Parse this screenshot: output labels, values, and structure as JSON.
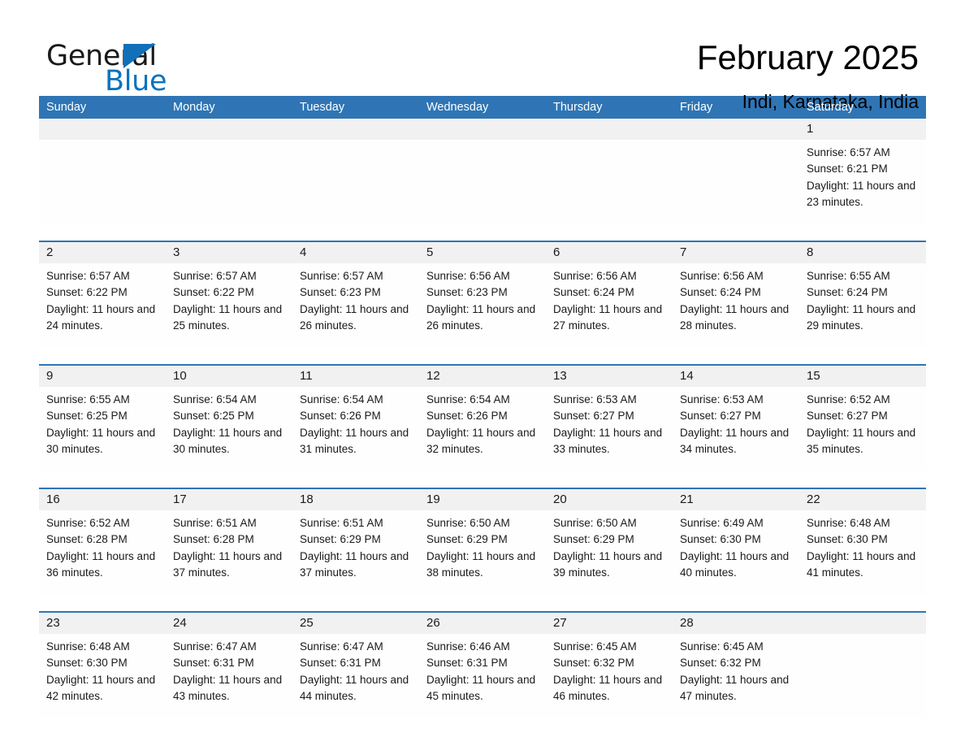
{
  "brand": {
    "name_part1": "General",
    "name_part2": "Blue",
    "logo_icon": "triangle-flag-icon"
  },
  "header": {
    "title": "February 2025",
    "location": "Indi, Karnataka, India"
  },
  "colors": {
    "header_blue": "#2f75b5",
    "brand_blue": "#0a72bd",
    "daynum_band": "#f1f1f1",
    "cell_bg": "#fefefe",
    "text": "#1a1a1a"
  },
  "calendar": {
    "weekday_headers": [
      "Sunday",
      "Monday",
      "Tuesday",
      "Wednesday",
      "Thursday",
      "Friday",
      "Saturday"
    ],
    "weeks": [
      [
        {
          "day": "",
          "sunrise": "",
          "sunset": "",
          "daylight": "",
          "empty": true
        },
        {
          "day": "",
          "sunrise": "",
          "sunset": "",
          "daylight": "",
          "empty": true
        },
        {
          "day": "",
          "sunrise": "",
          "sunset": "",
          "daylight": "",
          "empty": true
        },
        {
          "day": "",
          "sunrise": "",
          "sunset": "",
          "daylight": "",
          "empty": true
        },
        {
          "day": "",
          "sunrise": "",
          "sunset": "",
          "daylight": "",
          "empty": true
        },
        {
          "day": "",
          "sunrise": "",
          "sunset": "",
          "daylight": "",
          "empty": true
        },
        {
          "day": "1",
          "sunrise": "Sunrise: 6:57 AM",
          "sunset": "Sunset: 6:21 PM",
          "daylight": "Daylight: 11 hours and 23 minutes.",
          "empty": false
        }
      ],
      [
        {
          "day": "2",
          "sunrise": "Sunrise: 6:57 AM",
          "sunset": "Sunset: 6:22 PM",
          "daylight": "Daylight: 11 hours and 24 minutes.",
          "empty": false
        },
        {
          "day": "3",
          "sunrise": "Sunrise: 6:57 AM",
          "sunset": "Sunset: 6:22 PM",
          "daylight": "Daylight: 11 hours and 25 minutes.",
          "empty": false
        },
        {
          "day": "4",
          "sunrise": "Sunrise: 6:57 AM",
          "sunset": "Sunset: 6:23 PM",
          "daylight": "Daylight: 11 hours and 26 minutes.",
          "empty": false
        },
        {
          "day": "5",
          "sunrise": "Sunrise: 6:56 AM",
          "sunset": "Sunset: 6:23 PM",
          "daylight": "Daylight: 11 hours and 26 minutes.",
          "empty": false
        },
        {
          "day": "6",
          "sunrise": "Sunrise: 6:56 AM",
          "sunset": "Sunset: 6:24 PM",
          "daylight": "Daylight: 11 hours and 27 minutes.",
          "empty": false
        },
        {
          "day": "7",
          "sunrise": "Sunrise: 6:56 AM",
          "sunset": "Sunset: 6:24 PM",
          "daylight": "Daylight: 11 hours and 28 minutes.",
          "empty": false
        },
        {
          "day": "8",
          "sunrise": "Sunrise: 6:55 AM",
          "sunset": "Sunset: 6:24 PM",
          "daylight": "Daylight: 11 hours and 29 minutes.",
          "empty": false
        }
      ],
      [
        {
          "day": "9",
          "sunrise": "Sunrise: 6:55 AM",
          "sunset": "Sunset: 6:25 PM",
          "daylight": "Daylight: 11 hours and 30 minutes.",
          "empty": false
        },
        {
          "day": "10",
          "sunrise": "Sunrise: 6:54 AM",
          "sunset": "Sunset: 6:25 PM",
          "daylight": "Daylight: 11 hours and 30 minutes.",
          "empty": false
        },
        {
          "day": "11",
          "sunrise": "Sunrise: 6:54 AM",
          "sunset": "Sunset: 6:26 PM",
          "daylight": "Daylight: 11 hours and 31 minutes.",
          "empty": false
        },
        {
          "day": "12",
          "sunrise": "Sunrise: 6:54 AM",
          "sunset": "Sunset: 6:26 PM",
          "daylight": "Daylight: 11 hours and 32 minutes.",
          "empty": false
        },
        {
          "day": "13",
          "sunrise": "Sunrise: 6:53 AM",
          "sunset": "Sunset: 6:27 PM",
          "daylight": "Daylight: 11 hours and 33 minutes.",
          "empty": false
        },
        {
          "day": "14",
          "sunrise": "Sunrise: 6:53 AM",
          "sunset": "Sunset: 6:27 PM",
          "daylight": "Daylight: 11 hours and 34 minutes.",
          "empty": false
        },
        {
          "day": "15",
          "sunrise": "Sunrise: 6:52 AM",
          "sunset": "Sunset: 6:27 PM",
          "daylight": "Daylight: 11 hours and 35 minutes.",
          "empty": false
        }
      ],
      [
        {
          "day": "16",
          "sunrise": "Sunrise: 6:52 AM",
          "sunset": "Sunset: 6:28 PM",
          "daylight": "Daylight: 11 hours and 36 minutes.",
          "empty": false
        },
        {
          "day": "17",
          "sunrise": "Sunrise: 6:51 AM",
          "sunset": "Sunset: 6:28 PM",
          "daylight": "Daylight: 11 hours and 37 minutes.",
          "empty": false
        },
        {
          "day": "18",
          "sunrise": "Sunrise: 6:51 AM",
          "sunset": "Sunset: 6:29 PM",
          "daylight": "Daylight: 11 hours and 37 minutes.",
          "empty": false
        },
        {
          "day": "19",
          "sunrise": "Sunrise: 6:50 AM",
          "sunset": "Sunset: 6:29 PM",
          "daylight": "Daylight: 11 hours and 38 minutes.",
          "empty": false
        },
        {
          "day": "20",
          "sunrise": "Sunrise: 6:50 AM",
          "sunset": "Sunset: 6:29 PM",
          "daylight": "Daylight: 11 hours and 39 minutes.",
          "empty": false
        },
        {
          "day": "21",
          "sunrise": "Sunrise: 6:49 AM",
          "sunset": "Sunset: 6:30 PM",
          "daylight": "Daylight: 11 hours and 40 minutes.",
          "empty": false
        },
        {
          "day": "22",
          "sunrise": "Sunrise: 6:48 AM",
          "sunset": "Sunset: 6:30 PM",
          "daylight": "Daylight: 11 hours and 41 minutes.",
          "empty": false
        }
      ],
      [
        {
          "day": "23",
          "sunrise": "Sunrise: 6:48 AM",
          "sunset": "Sunset: 6:30 PM",
          "daylight": "Daylight: 11 hours and 42 minutes.",
          "empty": false
        },
        {
          "day": "24",
          "sunrise": "Sunrise: 6:47 AM",
          "sunset": "Sunset: 6:31 PM",
          "daylight": "Daylight: 11 hours and 43 minutes.",
          "empty": false
        },
        {
          "day": "25",
          "sunrise": "Sunrise: 6:47 AM",
          "sunset": "Sunset: 6:31 PM",
          "daylight": "Daylight: 11 hours and 44 minutes.",
          "empty": false
        },
        {
          "day": "26",
          "sunrise": "Sunrise: 6:46 AM",
          "sunset": "Sunset: 6:31 PM",
          "daylight": "Daylight: 11 hours and 45 minutes.",
          "empty": false
        },
        {
          "day": "27",
          "sunrise": "Sunrise: 6:45 AM",
          "sunset": "Sunset: 6:32 PM",
          "daylight": "Daylight: 11 hours and 46 minutes.",
          "empty": false
        },
        {
          "day": "28",
          "sunrise": "Sunrise: 6:45 AM",
          "sunset": "Sunset: 6:32 PM",
          "daylight": "Daylight: 11 hours and 47 minutes.",
          "empty": false
        },
        {
          "day": "",
          "sunrise": "",
          "sunset": "",
          "daylight": "",
          "empty": true
        }
      ]
    ]
  }
}
